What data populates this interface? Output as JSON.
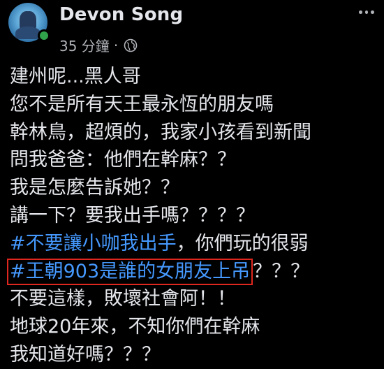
{
  "post": {
    "author": "Devon Song",
    "time": "35 分鐘",
    "separator": "·",
    "privacy_icon": "globe-icon",
    "lines": [
      "建州呢...黑人哥",
      "您不是所有天王最永恆的朋友嗎",
      "幹林鳥，超煩的，我家小孩看到新聞",
      "問我爸爸：他們在幹麻？？",
      "我是怎麼告訴她？？",
      "講一下？要我出手嗎？？？？"
    ],
    "hashtag1": "#不要讓小咖我出手",
    "hashtag1_rest": "，你們玩的很弱",
    "hashtag2": "#王朝903是誰的女朋友上吊",
    "hashtag2_rest": "？？？",
    "lines_after": [
      "不要這樣，敗壞社會阿！！",
      "地球20年來，不知你們在幹麻",
      "我知道好嗎？？？"
    ]
  },
  "colors": {
    "background": "#000000",
    "text": "#e4e6eb",
    "hashtag": "#4599ff",
    "highlight_box": "#e0271f",
    "online": "#31a24c"
  }
}
